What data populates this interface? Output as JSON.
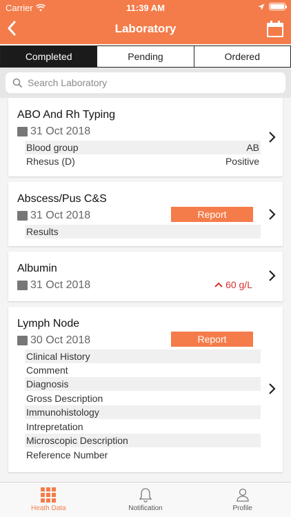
{
  "status_bar": {
    "carrier": "Carrier",
    "time": "11:39 AM"
  },
  "header": {
    "title": "Laboratory",
    "back_icon": "chevron-left-icon",
    "calendar_icon": "calendar-icon"
  },
  "tabs": [
    {
      "label": "Completed",
      "active": true
    },
    {
      "label": "Pending",
      "active": false
    },
    {
      "label": "Ordered",
      "active": false
    }
  ],
  "search": {
    "placeholder": "Search Laboratory"
  },
  "cards": [
    {
      "title": "ABO And Rh Typing",
      "date": "31 Oct 2018",
      "rows": [
        {
          "label": "Blood group",
          "value": "AB"
        },
        {
          "label": "Rhesus (D)",
          "value": "Positive"
        }
      ]
    },
    {
      "title": "Abscess/Pus C&S",
      "date": "31 Oct 2018",
      "report_label": "Report",
      "rows": [
        {
          "label": "Results",
          "value": ""
        }
      ]
    },
    {
      "title": "Albumin",
      "date": "31 Oct 2018",
      "result": "60 g/L",
      "result_flag": "high"
    },
    {
      "title": "Lymph Node",
      "date": "30 Oct 2018",
      "report_label": "Report",
      "rows": [
        {
          "label": "Clinical History"
        },
        {
          "label": "Comment"
        },
        {
          "label": "Diagnosis"
        },
        {
          "label": "Gross Description"
        },
        {
          "label": "Immunohistology"
        },
        {
          "label": "Intrepretation"
        },
        {
          "label": "Microscopic Description"
        },
        {
          "label": "Reference Number"
        }
      ]
    }
  ],
  "tabbar": [
    {
      "label": "Heath Data",
      "icon": "grid-icon",
      "active": true
    },
    {
      "label": "Notification",
      "icon": "bell-icon",
      "active": false
    },
    {
      "label": "Profile",
      "icon": "user-icon",
      "active": false
    }
  ],
  "colors": {
    "accent": "#f47c4a",
    "high_flag": "#d83030"
  }
}
